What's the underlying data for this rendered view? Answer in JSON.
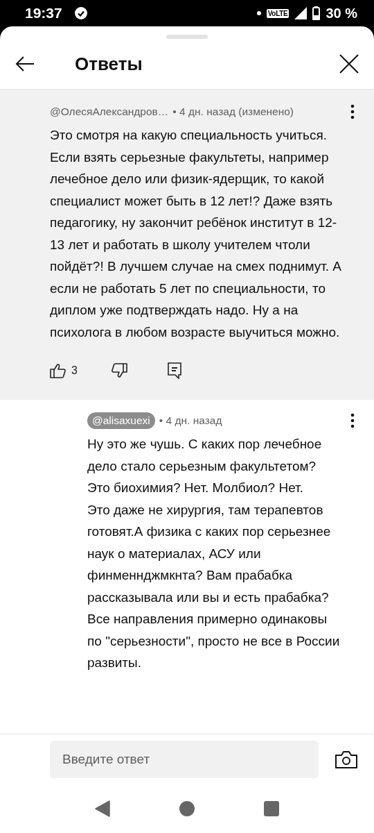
{
  "status_bar": {
    "time": "19:37",
    "network_badge": "VoLTE",
    "battery": "30 %"
  },
  "header": {
    "title": "Ответы"
  },
  "comments": [
    {
      "kind": "parent",
      "author": "@ОлесяАлександров…",
      "author_highlighted": false,
      "meta": "• 4 дн. назад (изменено)",
      "text": "Это смотря на какую специальность учиться. Если взять серьезные факультеты, например лечебное дело или физик-ядерщик, то какой специалист может быть в 12 лет!?  Даже взять педагогику, ну закончит ребёнок институт в 12-13 лет и работать в школу учителем чтоли пойдёт?! В лучшем случае на смех поднимут. А если не работать 5 лет по специальности, то диплом уже подтверждать надо. Ну а на психолога в любом возрасте выучиться можно.",
      "likes": "3"
    },
    {
      "kind": "reply",
      "author": "@alisaxuexi",
      "author_highlighted": true,
      "meta": "• 4 дн. назад",
      "text": "Ну это же чушь. С каких пор лечебное дело стало серьезным факультетом? Это биохимия? Нет. Молбиол? Нет.\nЭто даже не хирургия, там терапевтов готовят.А физика с каких пор серьезнее наук о материалах, АСУ или финменнджмкнта? Вам прабабка рассказывала или вы и есть прабабка?\nВсе направления примерно одинаковы по \"серьезности\", просто не все в России развиты."
    }
  ],
  "composer": {
    "placeholder": "Введите ответ"
  }
}
